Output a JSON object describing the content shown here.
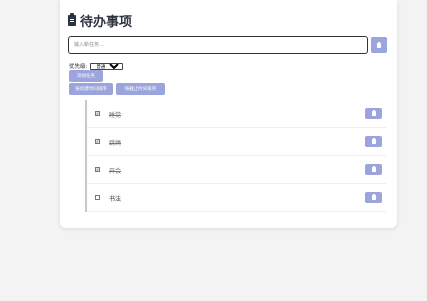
{
  "app": {
    "title": "待办事项",
    "title_icon": "clipboard-icon"
  },
  "input": {
    "placeholder": "输入新任务...",
    "value": ""
  },
  "priority": {
    "label": "优先级:",
    "selected": "普通"
  },
  "buttons": {
    "add_label": "添加任务",
    "sort_created_label": "按创建时间排序",
    "sort_deadline_label": "按截止时间排序",
    "add_icon": "clipboard-icon",
    "delete_icon": "trash-icon"
  },
  "tasks": [
    {
      "label": "睡觉",
      "done": true
    },
    {
      "label": "跳绳",
      "done": true
    },
    {
      "label": "开会",
      "done": true
    },
    {
      "label": "书法",
      "done": false
    }
  ],
  "colors": {
    "accent": "#9ba4dc",
    "title": "#2c3240",
    "background": "#f3f3f3"
  }
}
